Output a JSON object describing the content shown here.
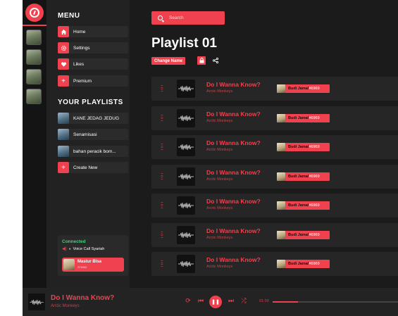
{
  "colors": {
    "accent": "#f0414e",
    "online": "#3ed37c",
    "background": "#1e1e1e"
  },
  "menu": {
    "title": "MENU",
    "items": [
      {
        "label": "Home",
        "icon": "home-icon"
      },
      {
        "label": "Settings",
        "icon": "gear-icon"
      },
      {
        "label": "Likes",
        "icon": "heart-icon"
      },
      {
        "label": "Premium",
        "icon": "plus-icon"
      }
    ]
  },
  "playlists": {
    "title": "YOUR PLAYLISTS",
    "items": [
      {
        "label": "KANE JEDAG JEDUG"
      },
      {
        "label": "Senamisasi"
      },
      {
        "label": "bahan peracik bom..."
      }
    ],
    "create_label": "Create New"
  },
  "connection": {
    "status": "Connected",
    "channel": "Voice Call Syariah",
    "user_name": "Mastur Bisa",
    "user_tag": "STAND"
  },
  "search": {
    "placeholder": "Search"
  },
  "playlist": {
    "title": "Playlist 01",
    "change_name_label": "Change Name"
  },
  "tracks": [
    {
      "title": "Do I Wanna Know?",
      "artist": "Arctic Monkeys",
      "added_by": "Budi Jamal",
      "added_by_tag": "#6969"
    },
    {
      "title": "Do I Wanna Know?",
      "artist": "Arctic Monkeys",
      "added_by": "Budi Jamal",
      "added_by_tag": "#6969"
    },
    {
      "title": "Do I Wanna Know?",
      "artist": "Arctic Monkeys",
      "added_by": "Budi Jamal",
      "added_by_tag": "#6969"
    },
    {
      "title": "Do I Wanna Know?",
      "artist": "Arctic Monkeys",
      "added_by": "Budi Jamal",
      "added_by_tag": "#6969"
    },
    {
      "title": "Do I Wanna Know?",
      "artist": "Arctic Monkeys",
      "added_by": "Budi Jamal",
      "added_by_tag": "#6969"
    },
    {
      "title": "Do I Wanna Know?",
      "artist": "Arctic Monkeys",
      "added_by": "Budi Jamal",
      "added_by_tag": "#6969"
    },
    {
      "title": "Do I Wanna Know?",
      "artist": "Arctic Monkeys",
      "added_by": "Budi Jamal",
      "added_by_tag": "#6969"
    }
  ],
  "player": {
    "title": "Do I Wanna Know?",
    "artist": "Arctic Monkeys",
    "elapsed": "01:00",
    "progress": 0.2
  }
}
